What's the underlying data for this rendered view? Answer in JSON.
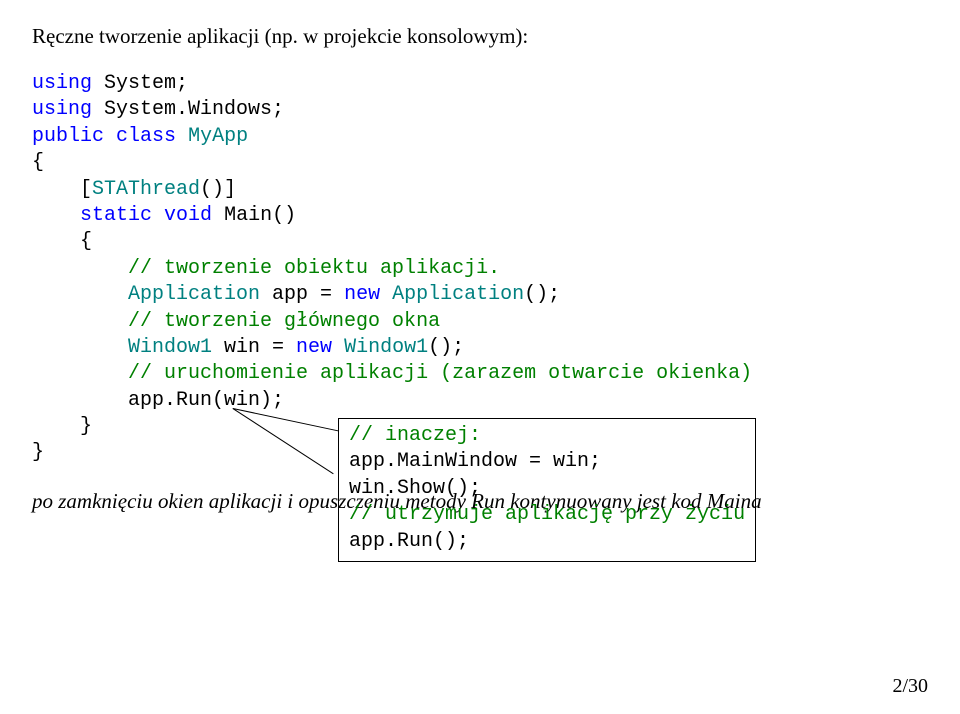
{
  "title": "Ręczne tworzenie aplikacji (np. w projekcie konsolowym):",
  "code": {
    "l01a": "using",
    "l01b": " System;",
    "l02a": "using",
    "l02b": " System.Windows;",
    "l03a": "public",
    "l03b": " ",
    "l03c": "class",
    "l03d": " ",
    "l03e": "MyApp",
    "l04": "{",
    "l05": "    [",
    "l05b": "STAThread",
    "l05c": "()]",
    "l06a": "    ",
    "l06b": "static",
    "l06c": " ",
    "l06d": "void",
    "l06e": " Main()",
    "l07": "    {",
    "l08": "        ",
    "l08b": "// tworzenie obiektu aplikacji.",
    "l09a": "        ",
    "l09b": "Application",
    "l09c": " app = ",
    "l09d": "new",
    "l09e": " ",
    "l09f": "Application",
    "l09g": "();",
    "l10": "        ",
    "l10b": "// tworzenie głównego okna",
    "l11a": "        ",
    "l11b": "Window1",
    "l11c": " win = ",
    "l11d": "new",
    "l11e": " ",
    "l11f": "Window1",
    "l11g": "();",
    "l12": "        ",
    "l12b": "// uruchomienie aplikacji (zarazem otwarcie okienka)",
    "l13": "        app.Run(win);",
    "l14": "    }",
    "l15": "}"
  },
  "callout": {
    "l1": "// inaczej:",
    "l2": "app.MainWindow = win;",
    "l3": "win.Show();",
    "l4": "// utrzymuje aplikację przy życiu",
    "l5": "app.Run();"
  },
  "footnote": "po zamknięciu okien aplikacji i opuszczeniu metody Run kontynuowany jest kod Maina",
  "pagenum": "2/30"
}
